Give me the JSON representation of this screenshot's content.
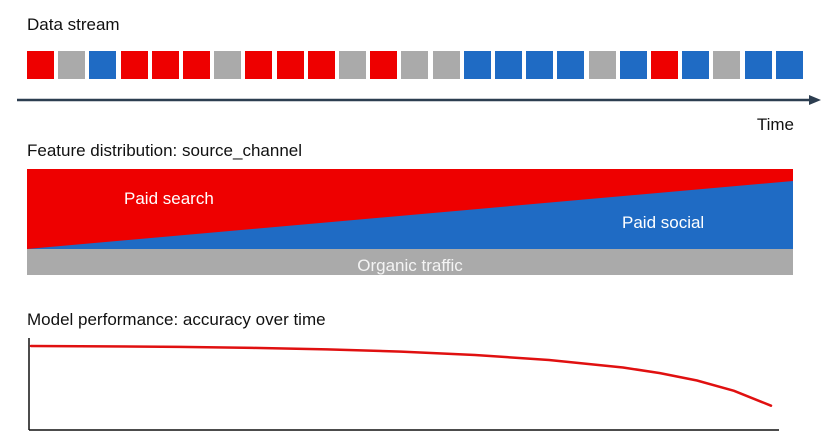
{
  "stream": {
    "title": "Data stream",
    "blocks": [
      "red",
      "grey",
      "blue",
      "red",
      "red",
      "red",
      "grey",
      "red",
      "red",
      "red",
      "grey",
      "red",
      "grey",
      "grey",
      "blue",
      "blue",
      "blue",
      "blue",
      "grey",
      "blue",
      "red",
      "blue",
      "grey",
      "blue",
      "blue"
    ],
    "time_label": "Time"
  },
  "feature": {
    "title_bold": "Feature distribution:",
    "title_rest": " source_channel",
    "paid_search": "Paid search",
    "paid_social": "Paid social",
    "organic": "Organic traffic"
  },
  "performance": {
    "title_bold": "Model performance:",
    "title_rest": " accuracy over time"
  },
  "colors": {
    "red": "#ee0000",
    "blue": "#1f6bc4",
    "grey": "#aaaaaa",
    "axis": "#2c3e50",
    "curve": "#e01010"
  },
  "chart_data": {
    "type": "line",
    "title": "accuracy over time",
    "xlabel": "",
    "ylabel": "",
    "series": [
      {
        "x": [
          0,
          0.1,
          0.2,
          0.3,
          0.4,
          0.5,
          0.6,
          0.7,
          0.8,
          0.85,
          0.9,
          0.95,
          1.0
        ],
        "values": [
          1.0,
          0.998,
          0.995,
          0.99,
          0.982,
          0.97,
          0.952,
          0.925,
          0.885,
          0.855,
          0.815,
          0.76,
          0.68
        ]
      }
    ],
    "ylim": [
      0,
      1.05
    ]
  }
}
